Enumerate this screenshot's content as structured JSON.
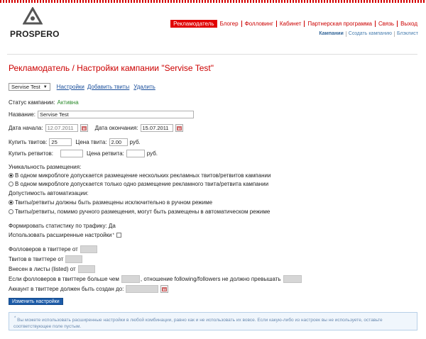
{
  "brand": {
    "name": "PROSPERO"
  },
  "nav": {
    "items": [
      "Рекламодатель",
      "Блогер",
      "Фолловинг",
      "Кабинет",
      "Партнерская программа",
      "Связь",
      "Выход"
    ],
    "active": 0
  },
  "subnav": [
    "Кампании",
    "Создать кампанию",
    "Блэклист"
  ],
  "page": {
    "title": "Рекламодатель / Настройки кампании \"Servise Test\""
  },
  "toolbar": {
    "campaign_select": "Servise Test",
    "links": [
      "Настройки",
      "Добавить твиты",
      "Удалить"
    ]
  },
  "status": {
    "label": "Статус кампании:",
    "value": "Активна"
  },
  "form": {
    "name_label": "Название:",
    "name_value": "Servise Test",
    "start_label": "Дата начала:",
    "start_value": "12.07.2011",
    "end_label": "Дата окончания:",
    "end_value": "15.07.2011",
    "buy_tweets_label": "Купить твитов:",
    "buy_tweets_value": "25",
    "tweet_price_label": "Цена твита:",
    "tweet_price_value": "2.00",
    "currency": "руб.",
    "buy_retweets_label": "Купить ретвитов:",
    "buy_retweets_value": "",
    "retweet_price_label": "Цена ретвита:",
    "retweet_price_value": "",
    "uniqueness_label": "Уникальность размещения:",
    "uniqueness_options": [
      "В одном микроблоге допускается размещение нескольких рекламных твитов/ретвитов кампании",
      "В одном микроблоге допускается только одно размещение рекламного твита/ретвита кампании"
    ],
    "uniqueness_selected": 0,
    "automation_label": "Допустимость автоматизации:",
    "automation_options": [
      "Твиты/ретвиты должны быть размещены исключительно в ручном режиме",
      "Твиты/ретвиты, помимо ручного размещения, могут быть размещены в автоматическом режиме"
    ],
    "automation_selected": 0,
    "stats_text": "Формировать статистику по трафику: Да",
    "advanced_label": "Использовать расширенные настройки",
    "advanced_sup": "*",
    "followers_label": "Фолловеров в твиттере от",
    "tweets_label": "Твитов в твиттере от",
    "listed_label": "Внесен в листы (listed) от",
    "ratio_label_a": "Если фолловеров в твиттере больше чем",
    "ratio_label_b": ", отношение following/followers не должно превышать",
    "created_label": "Аккаунт в твиттере должен быть создан до:",
    "submit_label": "Изменить настройки"
  },
  "note": {
    "sup": "*",
    "text": "Вы можете использовать расширенные настройки в любой комбинации, равно как и не использовать их вовсе. Если какую-либо из настроек вы не используете, оставьте соответствующее поле пустым."
  }
}
